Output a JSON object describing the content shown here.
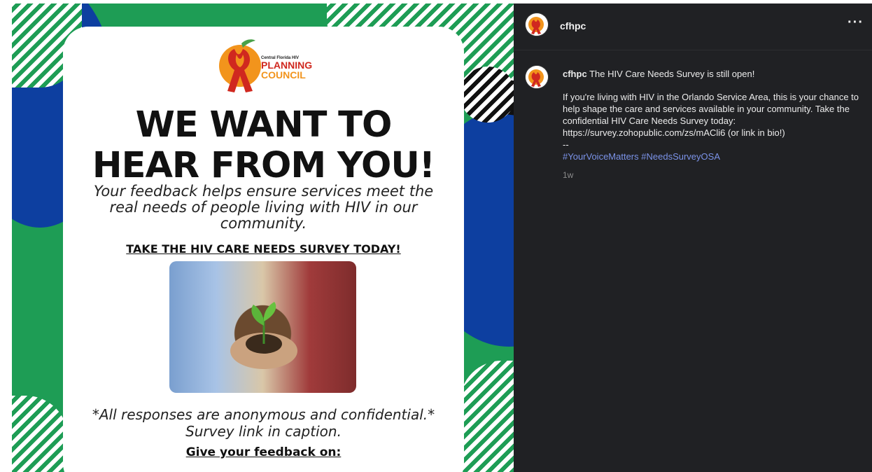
{
  "flyer": {
    "logo_small": "Central Florida HIV",
    "logo_line1": "PLANNING",
    "logo_line2": "COUNCIL",
    "headline_line1": "WE WANT TO",
    "headline_line2": "HEAR FROM YOU!",
    "subtext": "Your feedback helps ensure services meet the real needs of people living with HIV in our community.",
    "cta": "TAKE THE HIV CARE NEEDS SURVEY TODAY!",
    "anonymous_note": "*All responses are anonymous and confidential.* Survey link in caption.",
    "give_feedback": "Give your feedback on:"
  },
  "post": {
    "username": "cfhpc",
    "more_icon": "more-horizontal-icon",
    "caption_title": "The HIV Care Needs Survey is still open!",
    "caption_body": "If you're living with HIV in the Orlando Service Area, this is your chance to help shape the care and services available in your community. Take the confidential HIV Care Needs Survey today: https://survey.zohopublic.com/zs/mACli6 (or link in bio!)",
    "separator": "--",
    "hashtags": [
      "#YourVoiceMatters",
      "#NeedsSurveyOSA"
    ],
    "time": "1w"
  },
  "colors": {
    "sidebar_bg": "#202124",
    "hashtag": "#7b93e8",
    "brand_green": "#1e9d55",
    "brand_blue": "#0d3fa0",
    "ribbon_red": "#d0281f",
    "logo_orange": "#f2941c"
  }
}
